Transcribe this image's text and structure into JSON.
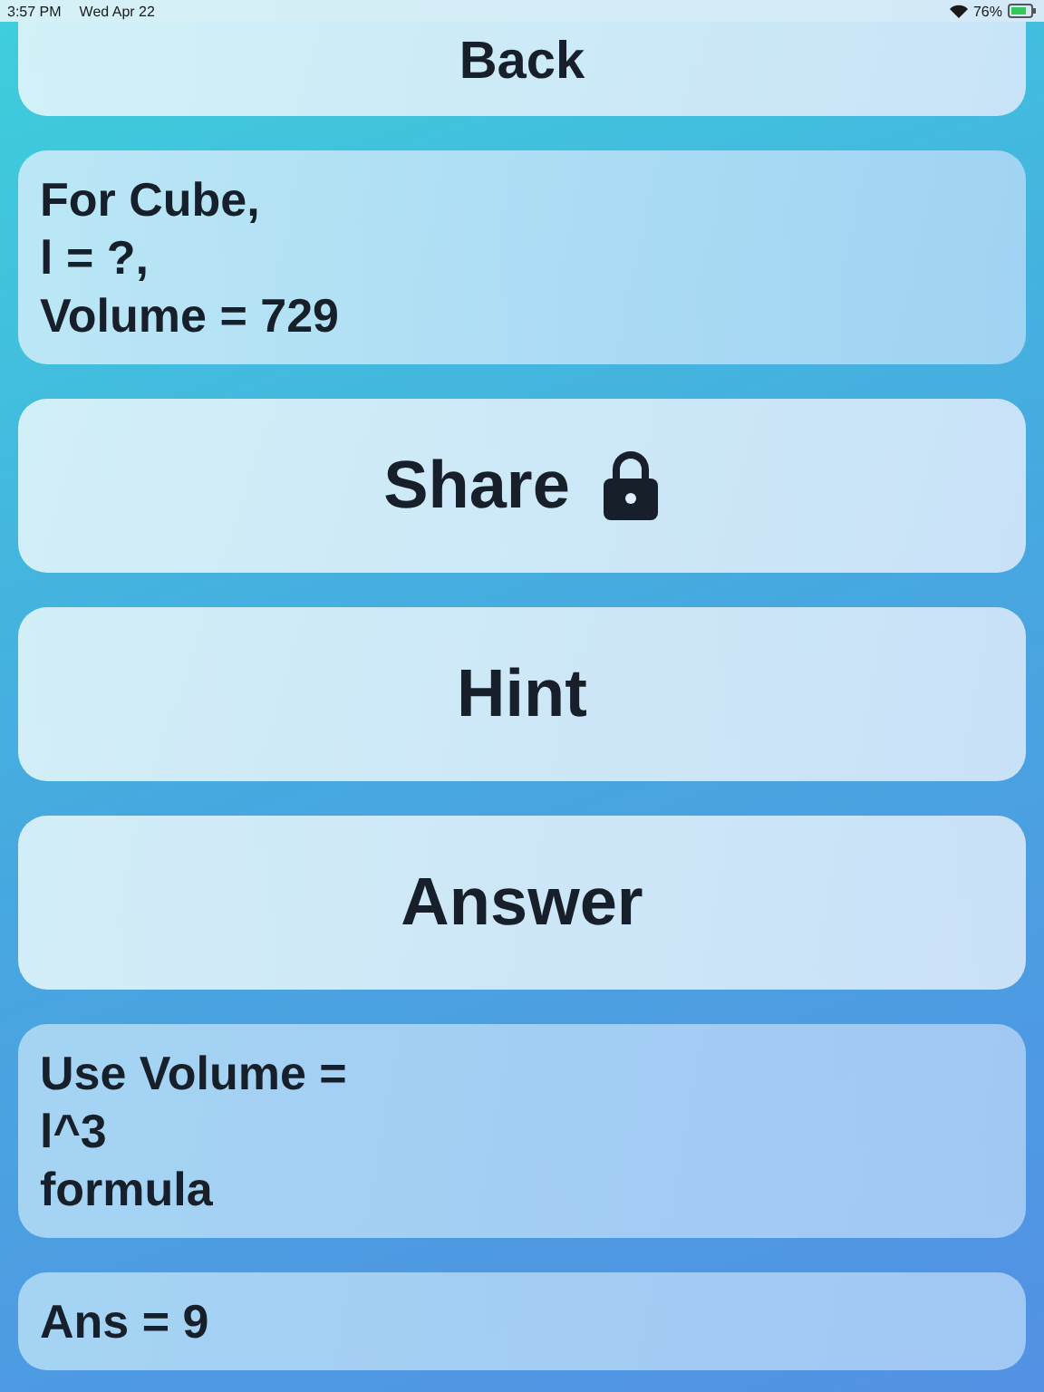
{
  "status_bar": {
    "time": "3:57 PM",
    "date": "Wed Apr 22",
    "battery": "76%"
  },
  "back_button": {
    "label": "Back"
  },
  "question": {
    "lines": [
      "For Cube,",
      "l = ?,",
      "Volume = 729"
    ]
  },
  "buttons": [
    {
      "label": "Share",
      "locked": true
    },
    {
      "label": "Hint",
      "locked": false
    },
    {
      "label": "Answer",
      "locked": false
    }
  ],
  "hint": {
    "lines": [
      "Use Volume =",
      "l^3",
      "formula"
    ]
  },
  "answer": {
    "text": "Ans = 9"
  }
}
